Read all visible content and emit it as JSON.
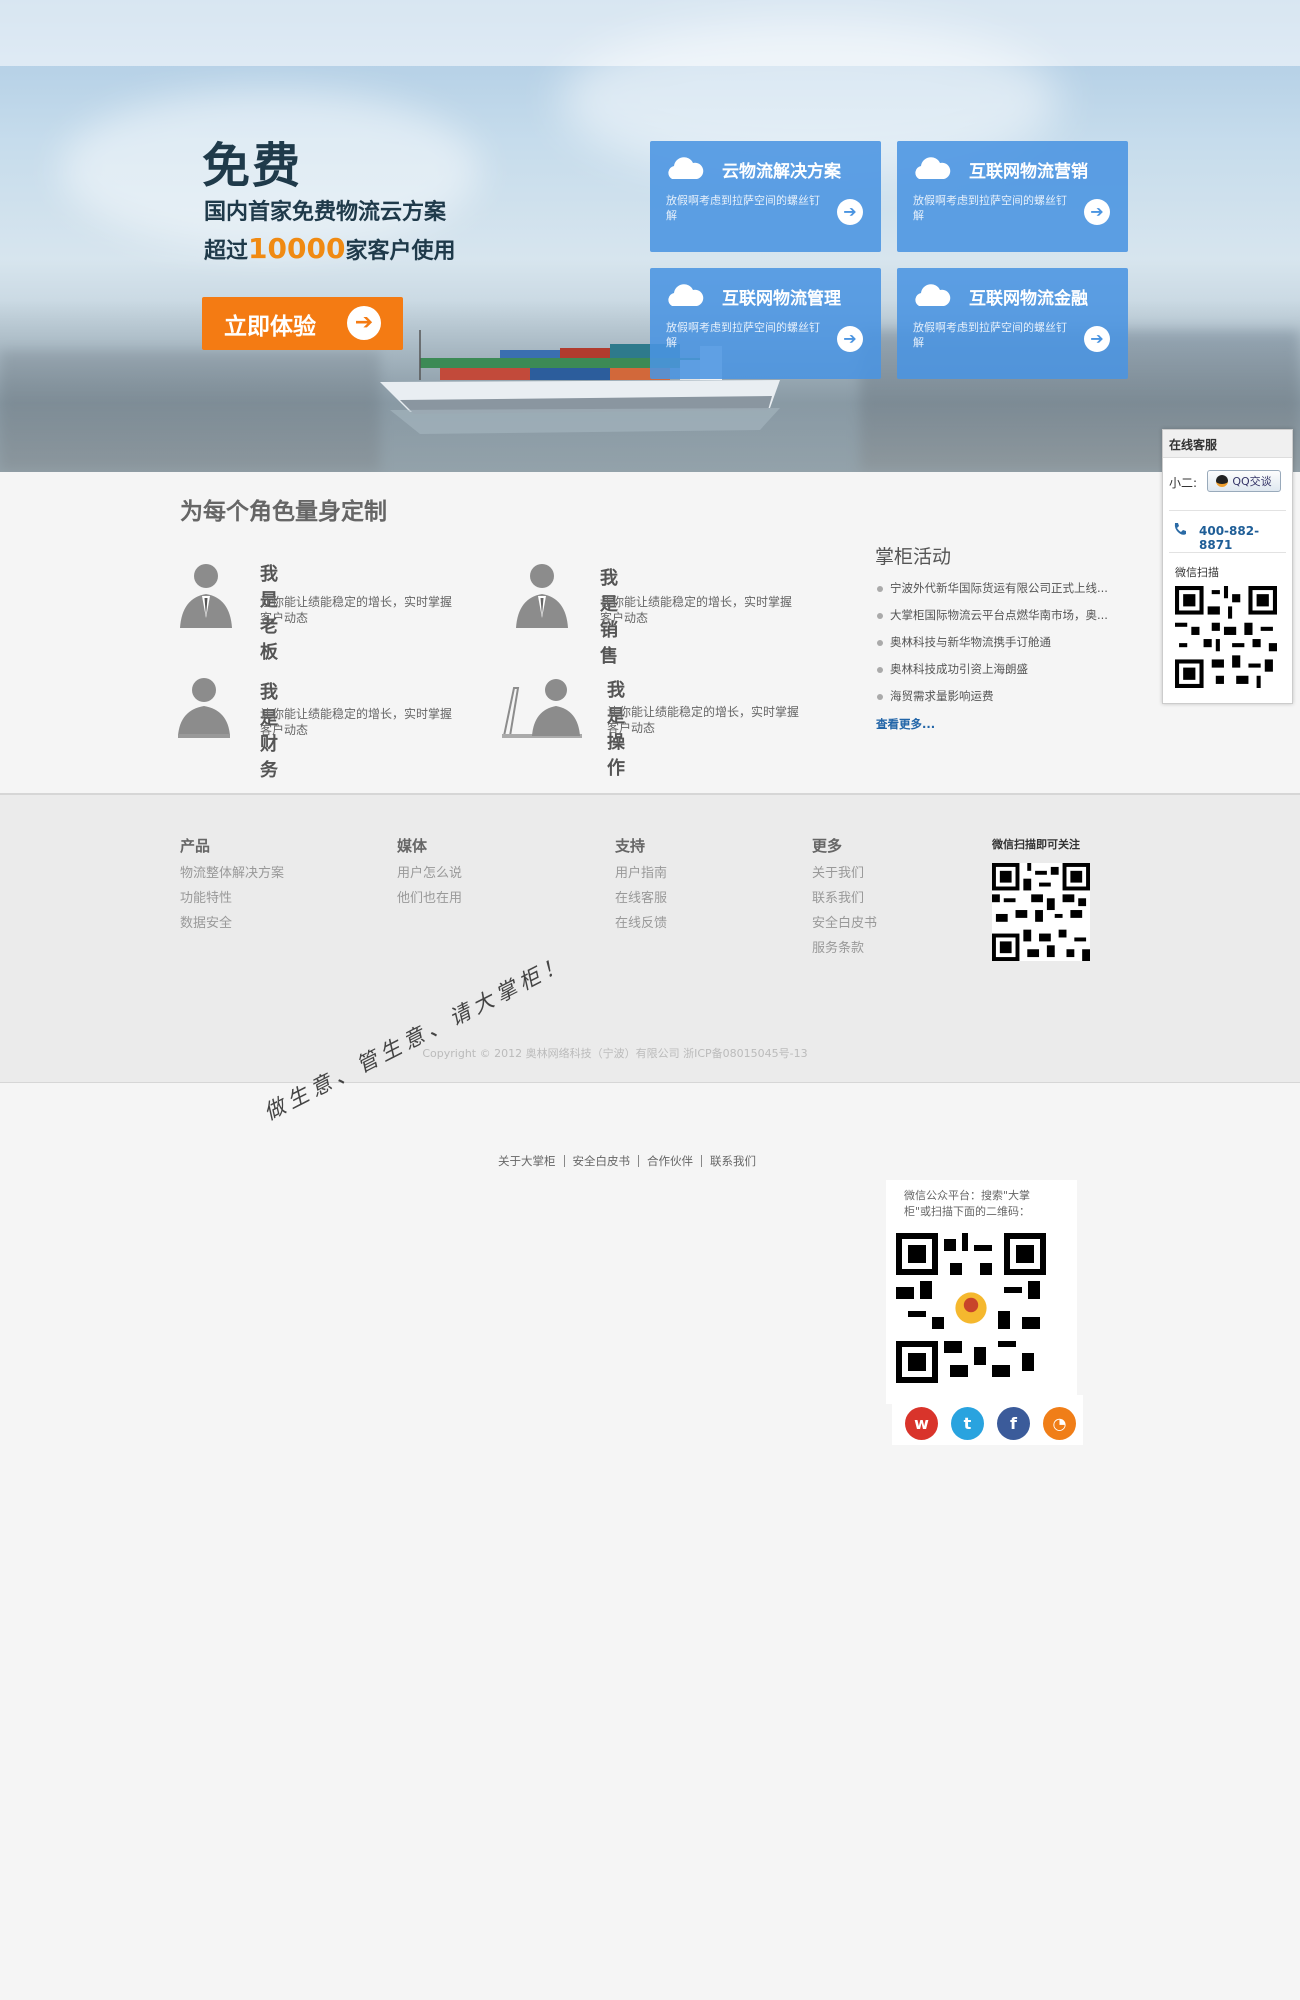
{
  "hero": {
    "free": "免费",
    "line1": "国内首家免费物流云方案",
    "line2_prefix": "超过",
    "line2_num": "10000",
    "line2_suffix": "家客户使用",
    "cta": "立即体验"
  },
  "tiles": [
    {
      "title": "云物流解决方案",
      "desc": "放假啊考虑到拉萨空间的螺丝钉解"
    },
    {
      "title": "互联网物流营销",
      "desc": "放假啊考虑到拉萨空间的螺丝钉解"
    },
    {
      "title": "互联网物流管理",
      "desc": "放假啊考虑到拉萨空间的螺丝钉解"
    },
    {
      "title": "互联网物流金融",
      "desc": "放假啊考虑到拉萨空间的螺丝钉解"
    }
  ],
  "roles": {
    "title": "为每个角色量身定制",
    "items": [
      {
        "name": "我是老板",
        "desc": "让你能让绩能稳定的增长，实时掌握客户动态"
      },
      {
        "name": "我是销售",
        "desc": "让你能让绩能稳定的增长，实时掌握客户动态"
      },
      {
        "name": "我是财务",
        "desc": "让你能让绩能稳定的增长，实时掌握客户动态"
      },
      {
        "name": "我是操作",
        "desc": "让你能让绩能稳定的增长，实时掌握客户动态"
      }
    ]
  },
  "news": {
    "title": "掌柜活动",
    "items": [
      "宁波外代新华国际货运有限公司正式上线...",
      "大掌柜国际物流云平台点燃华南市场，奥...",
      "奥林科技与新华物流携手订舱通",
      "奥林科技成功引资上海朗盛",
      "海贸需求量影响运费"
    ],
    "more": "查看更多..."
  },
  "service": {
    "head": "在线客服",
    "qq_label": "小二:",
    "qq_button": "QQ交谈",
    "phone": "400-882-8871",
    "wechat": "微信扫描"
  },
  "footer": {
    "cols": [
      {
        "title": "产品",
        "links": [
          "物流整体解决方案",
          "功能特性",
          "数据安全"
        ]
      },
      {
        "title": "媒体",
        "links": [
          "用户怎么说",
          "他们也在用"
        ]
      },
      {
        "title": "支持",
        "links": [
          "用户指南",
          "在线客服",
          "在线反馈"
        ]
      },
      {
        "title": "更多",
        "links": [
          "关于我们",
          "联系我们",
          "安全白皮书",
          "服务条款"
        ]
      }
    ],
    "qr_title": "微信扫描即可关注",
    "copyright": "Copyright © 2012 奥林网络科技（宁波）有限公司 浙ICP备08015045号-13"
  },
  "bottom": {
    "slogan": "做生意、管生意、请大掌柜！",
    "links": [
      "关于大掌柜",
      "安全白皮书",
      "合作伙伴",
      "联系我们"
    ],
    "wechat_text": "微信公众平台：搜索\"大掌柜\"或扫描下面的二维码：",
    "social_icons": [
      "weibo-icon",
      "twitter-icon",
      "facebook-icon",
      "rss-icon"
    ]
  },
  "colors": {
    "accent_orange": "#f47b13",
    "tile_blue": "#4a94e1",
    "link_blue": "#2265a8"
  }
}
